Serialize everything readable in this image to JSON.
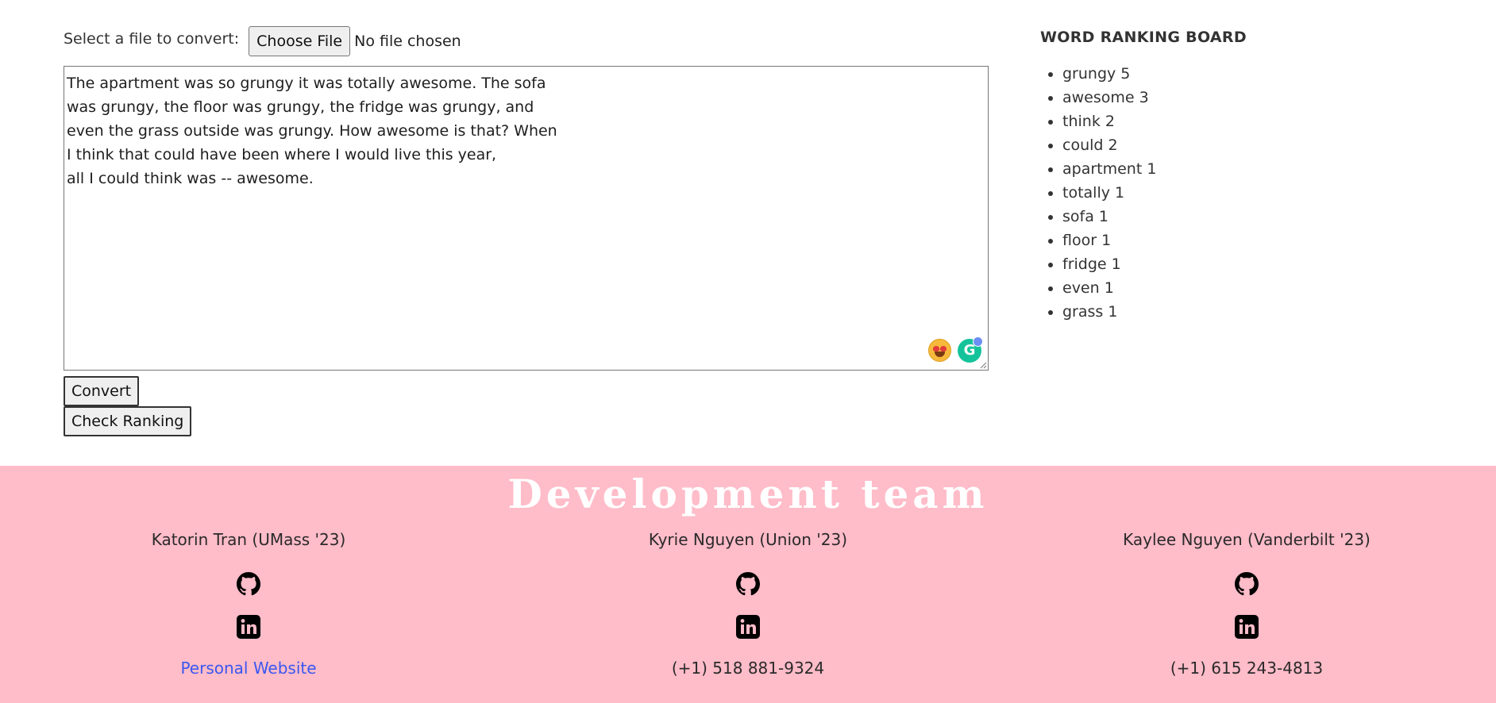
{
  "upload": {
    "label": "Select a file to convert:",
    "button_label": "Choose File",
    "status": "No file chosen"
  },
  "editor": {
    "text": "The apartment was so grungy it was totally awesome. The sofa\nwas grungy, the floor was grungy, the fridge was grungy, and\neven the grass outside was grungy. How awesome is that? When\nI think that could have been where I would live this year,\nall I could think was -- awesome.",
    "grammarly_letter": "G"
  },
  "buttons": {
    "convert": "Convert",
    "check_ranking": "Check Ranking"
  },
  "ranking": {
    "title": "WORD RANKING BOARD",
    "items": [
      "grungy 5",
      "awesome 3",
      "think 2",
      "could 2",
      "apartment 1",
      "totally 1",
      "sofa 1",
      "floor 1",
      "fridge 1",
      "even 1",
      "grass 1"
    ]
  },
  "footer": {
    "title": "Development team",
    "background_color": "#ffbcc9",
    "members": [
      {
        "name": "Katorin Tran (UMass '23)",
        "icons": [
          "github-icon",
          "linkedin-icon"
        ],
        "contact": "Personal Website",
        "contact_is_link": true
      },
      {
        "name": "Kyrie Nguyen (Union '23)",
        "icons": [
          "github-icon",
          "linkedin-icon"
        ],
        "contact": "(+1) 518 881-9324",
        "contact_is_link": false
      },
      {
        "name": "Kaylee Nguyen (Vanderbilt '23)",
        "icons": [
          "github-icon",
          "linkedin-icon"
        ],
        "contact": "(+1) 615 243-4813",
        "contact_is_link": false
      }
    ]
  }
}
